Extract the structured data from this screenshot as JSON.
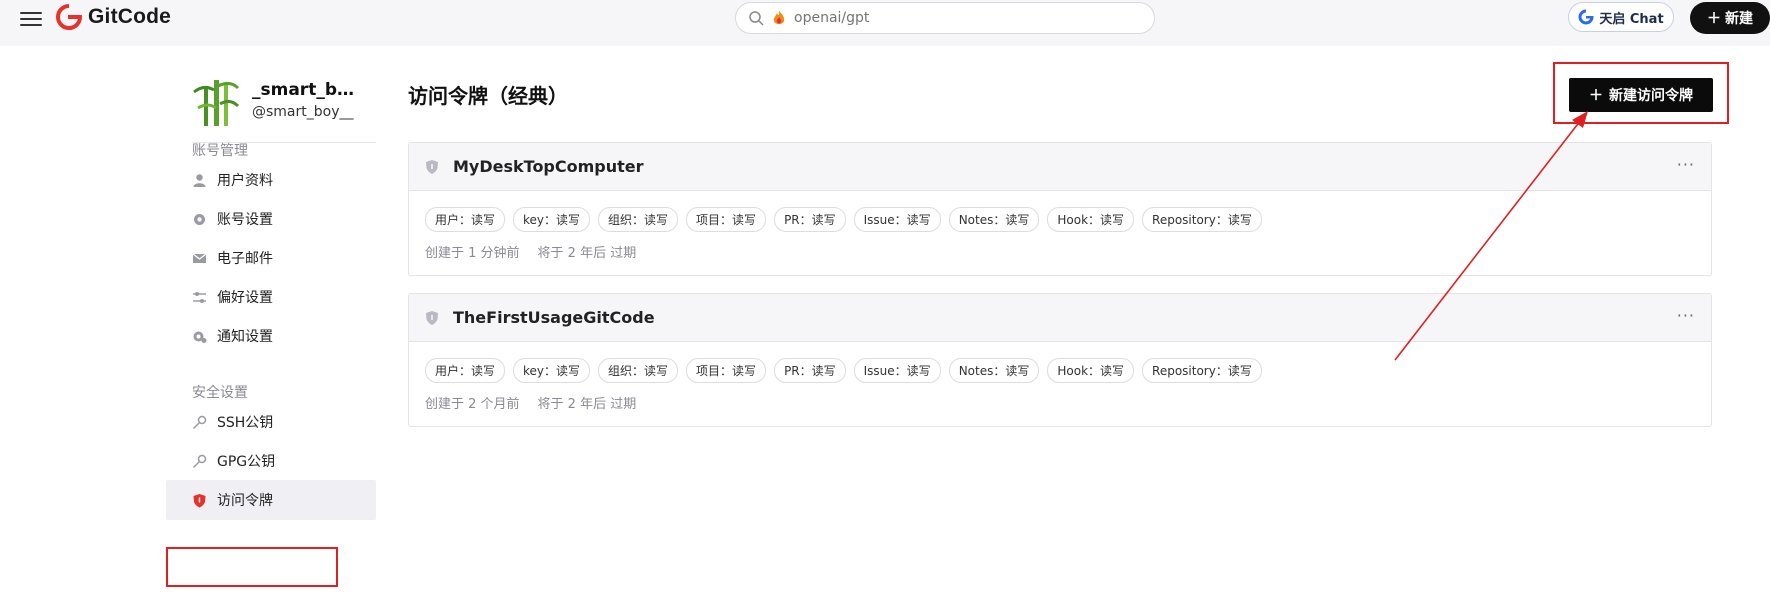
{
  "header": {
    "logo_text": "GitCode",
    "search_placeholder": "openai/gpt",
    "chat_button": "天启 Chat",
    "new_button": "新建"
  },
  "profile": {
    "name": "_smart_bo…",
    "handle": "@smart_boy__"
  },
  "sidebar": {
    "account_section": "账号管理",
    "account_items": [
      {
        "label": "用户资料",
        "icon": "user-icon"
      },
      {
        "label": "账号设置",
        "icon": "gear-icon"
      },
      {
        "label": "电子邮件",
        "icon": "mail-icon"
      },
      {
        "label": "偏好设置",
        "icon": "sliders-icon"
      },
      {
        "label": "通知设置",
        "icon": "notification-gear-icon"
      }
    ],
    "security_section": "安全设置",
    "security_items": [
      {
        "label": "SSH公钥",
        "icon": "key-icon"
      },
      {
        "label": "GPG公钥",
        "icon": "key-icon"
      },
      {
        "label": "访问令牌",
        "icon": "shield-icon",
        "active": true
      }
    ]
  },
  "main": {
    "title": "访问令牌（经典）",
    "create_button": "新建访问令牌",
    "tokens": [
      {
        "name": "MyDeskTopComputer",
        "scopes": [
          "用户：读写",
          "key：读写",
          "组织：读写",
          "项目：读写",
          "PR：读写",
          "Issue：读写",
          "Notes：读写",
          "Hook：读写",
          "Repository：读写"
        ],
        "created": "创建于 1 分钟前",
        "expires": "将于 2 年后 过期"
      },
      {
        "name": "TheFirstUsageGitCode",
        "scopes": [
          "用户：读写",
          "key：读写",
          "组织：读写",
          "项目：读写",
          "PR：读写",
          "Issue：读写",
          "Notes：读写",
          "Hook：读写",
          "Repository：读写"
        ],
        "created": "创建于 2 个月前",
        "expires": "将于 2 年后 过期"
      }
    ],
    "more_label": "···"
  },
  "colors": {
    "accent": "#e02020",
    "brand_red": "#e5322d",
    "button_dark": "#0b0b0b"
  }
}
